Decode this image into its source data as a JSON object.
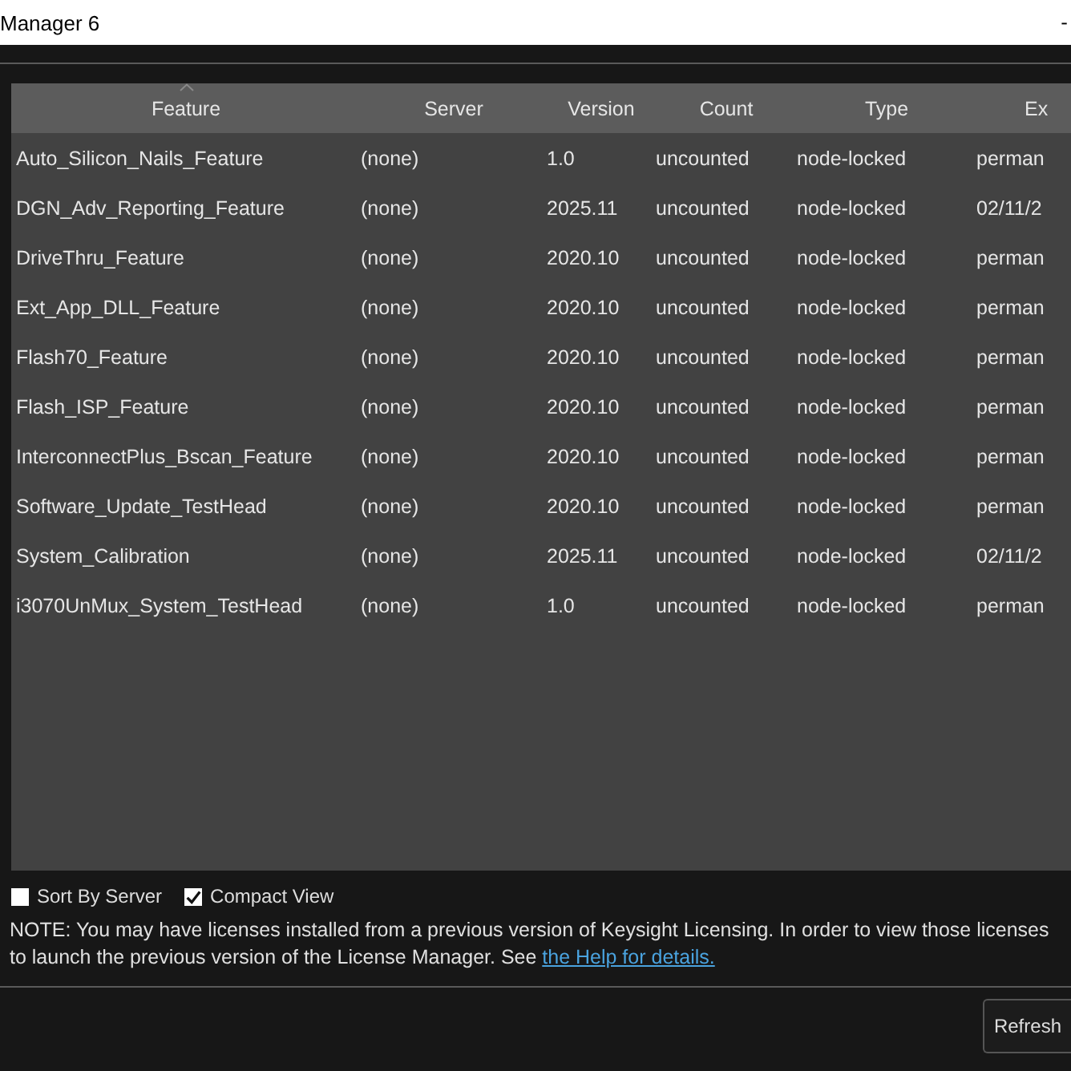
{
  "window": {
    "title": "Manager 6",
    "minimize": "-"
  },
  "table": {
    "columns": [
      {
        "label": "Feature",
        "sorted": true
      },
      {
        "label": "Server",
        "sorted": false
      },
      {
        "label": "Version",
        "sorted": false
      },
      {
        "label": "Count",
        "sorted": false
      },
      {
        "label": "Type",
        "sorted": false
      },
      {
        "label": "Ex",
        "sorted": false
      }
    ],
    "rows": [
      [
        "Auto_Silicon_Nails_Feature",
        "(none)",
        "1.0",
        "uncounted",
        "node-locked",
        "perman"
      ],
      [
        "DGN_Adv_Reporting_Feature",
        "(none)",
        "2025.11",
        "uncounted",
        "node-locked",
        "02/11/2"
      ],
      [
        "DriveThru_Feature",
        "(none)",
        "2020.10",
        "uncounted",
        "node-locked",
        "perman"
      ],
      [
        "Ext_App_DLL_Feature",
        "(none)",
        "2020.10",
        "uncounted",
        "node-locked",
        "perman"
      ],
      [
        "Flash70_Feature",
        "(none)",
        "2020.10",
        "uncounted",
        "node-locked",
        "perman"
      ],
      [
        "Flash_ISP_Feature",
        "(none)",
        "2020.10",
        "uncounted",
        "node-locked",
        "perman"
      ],
      [
        "InterconnectPlus_Bscan_Feature",
        "(none)",
        "2020.10",
        "uncounted",
        "node-locked",
        "perman"
      ],
      [
        "Software_Update_TestHead",
        "(none)",
        "2020.10",
        "uncounted",
        "node-locked",
        "perman"
      ],
      [
        "System_Calibration",
        "(none)",
        "2025.11",
        "uncounted",
        "node-locked",
        "02/11/2"
      ],
      [
        "i3070UnMux_System_TestHead",
        "(none)",
        "1.0",
        "uncounted",
        "node-locked",
        "perman"
      ]
    ]
  },
  "options": [
    {
      "label": "Sort By Server",
      "checked": false
    },
    {
      "label": "Compact View",
      "checked": true
    }
  ],
  "note": {
    "lines": [
      "NOTE: You may have licenses installed from a previous version of Keysight Licensing. In order to view those licenses",
      "to launch the previous version of the License Manager. See "
    ],
    "link": "the Help for details."
  },
  "buttons": [
    "Refresh"
  ]
}
